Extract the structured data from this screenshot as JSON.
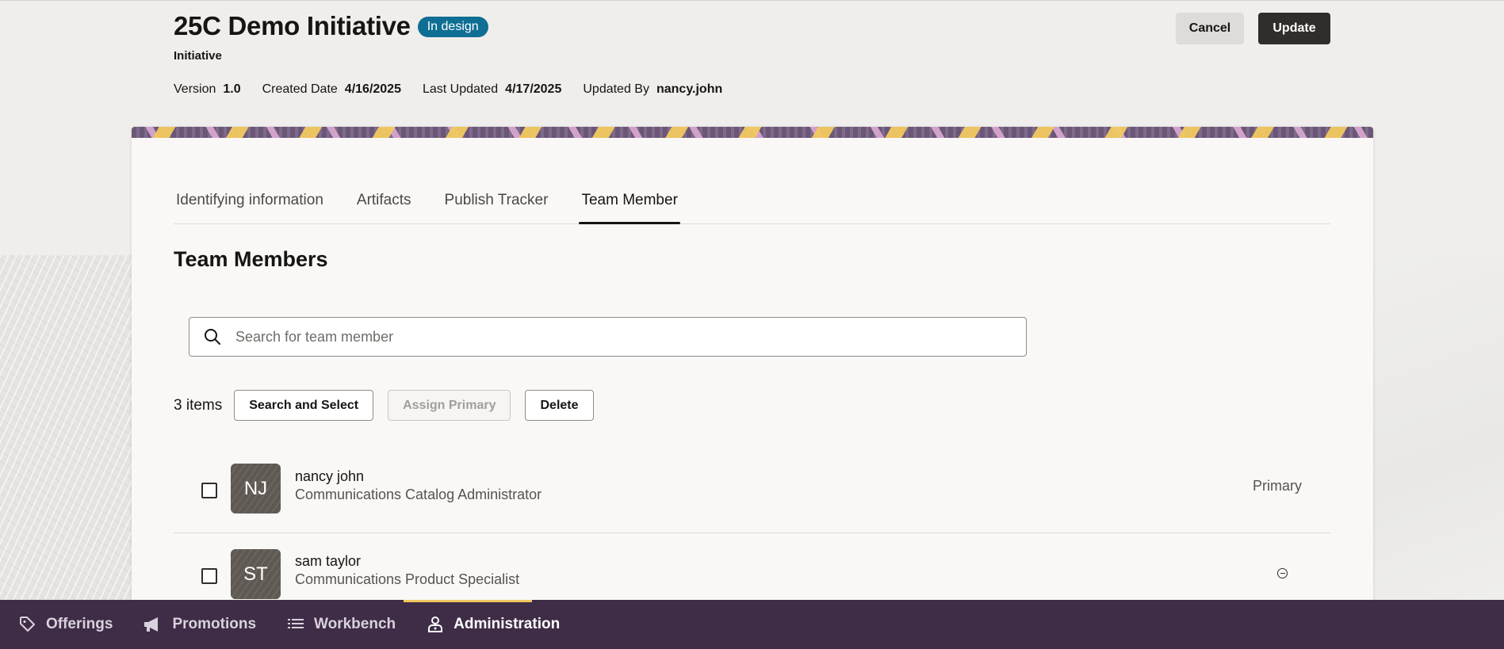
{
  "header": {
    "title": "25C Demo Initiative",
    "status": "In design",
    "subtitle": "Initiative",
    "meta": [
      {
        "label": "Version",
        "value": "1.0"
      },
      {
        "label": "Created Date",
        "value": "4/16/2025"
      },
      {
        "label": "Last Updated",
        "value": "4/17/2025"
      },
      {
        "label": "Updated By",
        "value": "nancy.john"
      }
    ],
    "cancel_label": "Cancel",
    "update_label": "Update"
  },
  "tabs": [
    {
      "label": "Identifying information"
    },
    {
      "label": "Artifacts"
    },
    {
      "label": "Publish Tracker"
    },
    {
      "label": "Team Member",
      "active": true
    }
  ],
  "section": {
    "title": "Team Members",
    "search_placeholder": "Search for team member",
    "items_count": "3 items",
    "search_select_label": "Search and Select",
    "assign_primary_label": "Assign Primary",
    "delete_label": "Delete"
  },
  "members": [
    {
      "initials": "NJ",
      "name": "nancy john",
      "role": "Communications Catalog Administrator",
      "tag": "Primary"
    },
    {
      "initials": "ST",
      "name": "sam taylor",
      "role": "Communications Product Specialist",
      "action_icon": "remove-circle-icon"
    }
  ],
  "bottom_nav": [
    {
      "label": "Offerings",
      "icon": "tag-icon"
    },
    {
      "label": "Promotions",
      "icon": "megaphone-icon"
    },
    {
      "label": "Workbench",
      "icon": "list-icon"
    },
    {
      "label": "Administration",
      "icon": "admin-icon",
      "active": true
    }
  ],
  "colors": {
    "status_badge": "#0f6e93",
    "primary_button": "#312d2a",
    "bottom_nav": "#3f2d47",
    "nav_accent": "#f2c960"
  }
}
